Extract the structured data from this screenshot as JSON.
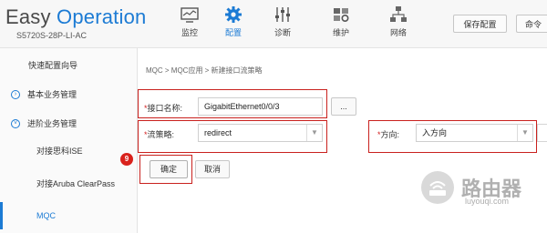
{
  "header": {
    "logo_easy": "Easy",
    "logo_operation": "Operation",
    "model": "S5720S-28P-LI-AC",
    "nav": [
      {
        "label": "监控",
        "icon": "monitor-icon"
      },
      {
        "label": "配置",
        "icon": "gear-icon"
      },
      {
        "label": "诊断",
        "icon": "sliders-icon"
      },
      {
        "label": "维护",
        "icon": "maintenance-icon"
      },
      {
        "label": "网络",
        "icon": "network-tree-icon"
      }
    ],
    "save_label": "保存配置",
    "cmd_label": "命令"
  },
  "sidebar": {
    "items": [
      {
        "label": "快速配置向导"
      },
      {
        "label": "基本业务管理"
      },
      {
        "label": "进阶业务管理"
      },
      {
        "label": "对接思科ISE"
      },
      {
        "label": "对接Aruba ClearPass"
      },
      {
        "label": "MQC"
      }
    ]
  },
  "main": {
    "breadcrumb": "MQC > MQC应用 > 新建接口流策略",
    "interface_label": "接口名称:",
    "interface_value": "GigabitEthernet0/0/3",
    "browse_label": "...",
    "policy_label": "流策略:",
    "policy_value": "redirect",
    "direction_label": "方向:",
    "direction_value": "入方向",
    "ok_label": "确定",
    "cancel_label": "取消",
    "step_badge": "9"
  },
  "watermark": {
    "title": "路由器",
    "subtitle": "luyouqi.com"
  },
  "colors": {
    "accent": "#1c7bd4",
    "highlight_red": "#c9211e"
  }
}
